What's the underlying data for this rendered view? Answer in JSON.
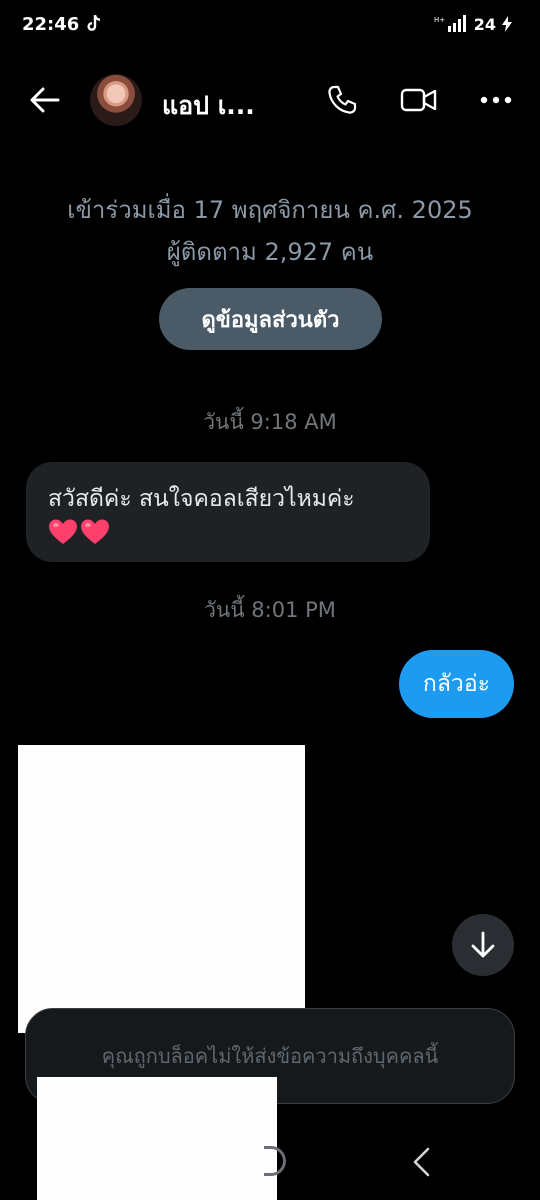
{
  "status_bar": {
    "time": "22:46",
    "battery": "24"
  },
  "header": {
    "contact_name": "แอป เ...",
    "icons": {
      "back": "arrow-left-icon",
      "call": "phone-icon",
      "video": "video-camera-icon",
      "more": "more-horizontal-icon"
    }
  },
  "profile": {
    "joined": "เข้าร่วมเมื่อ 17 พฤศจิกายน ค.ศ. 2025",
    "followers": "ผู้ติดตาม 2,927 คน",
    "view_profile_label": "ดูข้อมูลส่วนตัว"
  },
  "messages": [
    {
      "type": "timestamp",
      "text": "วันนี้ 9:18 AM"
    },
    {
      "type": "received",
      "text": "สวัสดีค่ะ สนใจคอลเสียวไหมค่ะ",
      "emoji": [
        "heart-icon",
        "heart-icon"
      ]
    },
    {
      "type": "timestamp",
      "text": "วันนี้ 8:01 PM"
    },
    {
      "type": "sent",
      "text": "กลัวอ่ะ"
    }
  ],
  "composer": {
    "blocked_notice": "คุณถูกบล็อคไม่ให้ส่งข้อความถึงบุคคลนี้"
  },
  "colors": {
    "background": "#000000",
    "sent_bubble": "#1d9bf0",
    "received_bubble": "#1f2225",
    "profile_button": "#4a5a66",
    "heart": "#ff3f6c",
    "muted_text": "#8b98a5"
  }
}
